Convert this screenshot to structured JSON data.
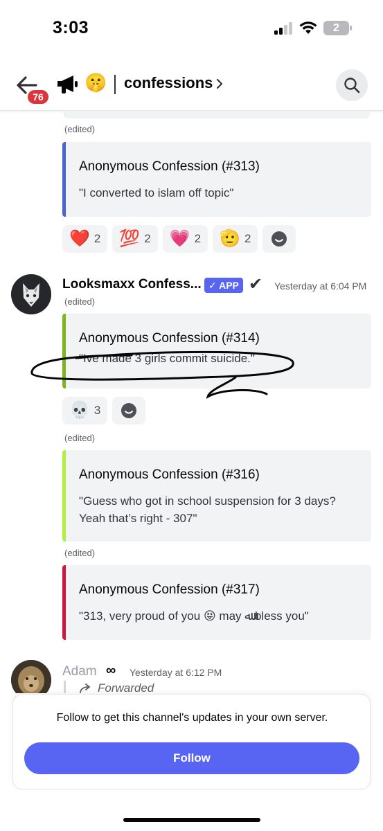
{
  "status_bar": {
    "time": "3:03",
    "battery_level": "2"
  },
  "header": {
    "unread_badge": "76",
    "channel_emoji": "🤫",
    "channel_name": "confessions"
  },
  "feed": {
    "top_edited": "(edited)",
    "embed_313": {
      "title": "Anonymous Confession (#313)",
      "text": "\"I converted to islam off topic\"",
      "accent": "#4a62d8"
    },
    "reactions_313": [
      {
        "emoji": "❤️",
        "count": "2"
      },
      {
        "emoji": "💯",
        "count": "2"
      },
      {
        "emoji": "💗",
        "count": "2"
      },
      {
        "emoji": "🫡",
        "count": "2"
      }
    ],
    "message_2": {
      "author": "Looksmaxx Confess...",
      "app_tag": "✓ APP",
      "check_mark": "✔",
      "timestamp": "Yesterday at 6:04 PM",
      "edited": "(edited)"
    },
    "embed_314": {
      "title": "Anonymous Confession (#314)",
      "text": "\"Ive made 3 girls commit suicide.\"",
      "accent": "#7cb518"
    },
    "reactions_314": [
      {
        "emoji": "💀",
        "count": "3"
      }
    ],
    "edited_316": "(edited)",
    "embed_316": {
      "title": "Anonymous Confession (#316)",
      "text_line1": "\"Guess who got in school suspension for 3 days?",
      "text_line2": "Yeah that’s right - 307\"",
      "accent": "#aef03c"
    },
    "edited_317": "(edited)",
    "embed_317": {
      "title": "Anonymous Confession (#317)",
      "text_part1": "\"313, very proud of you",
      "text_emoji": "😝",
      "text_part2": "may",
      "text_glyph": "ﷲ",
      "text_part3": "bless you\"",
      "accent": "#d0163c"
    },
    "message_3": {
      "author": "Adam",
      "author_icon": "∞",
      "timestamp": "Yesterday at 6:12 PM",
      "forwarded": "Forwarded"
    }
  },
  "follow_sheet": {
    "text": "Follow to get this channel's updates in your own server.",
    "button_label": "Follow",
    "button_color": "#5865f2"
  }
}
